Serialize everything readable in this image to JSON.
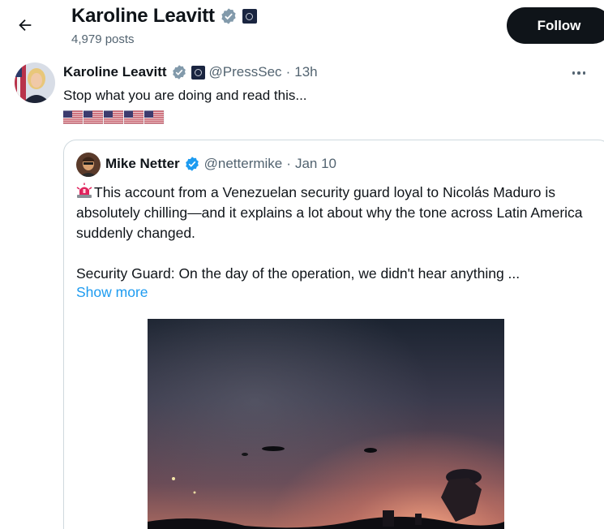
{
  "header": {
    "name": "Karoline Leavitt",
    "post_count": "4,979 posts",
    "follow_label": "Follow"
  },
  "post": {
    "author_name": "Karoline Leavitt",
    "handle": "@PressSec",
    "separator": "·",
    "time": "13h",
    "text": "Stop what you are doing and read this...",
    "flags": [
      "us-flag-emoji",
      "us-flag-emoji",
      "us-flag-emoji",
      "us-flag-emoji",
      "us-flag-emoji"
    ]
  },
  "quote": {
    "author_name": "Mike Netter",
    "handle": "@nettermike",
    "separator": "·",
    "date": "Jan 10",
    "paragraph1": "This account from a Venezuelan security guard loyal to Nicolás Maduro is absolutely chilling—and it explains a lot about why the tone across Latin America suddenly changed.",
    "paragraph2": "Security Guard: On the day of the operation, we didn't hear anything ...",
    "show_more": "Show more"
  },
  "icons": {
    "back": "arrow-left-icon",
    "verified": "verified-badge-icon",
    "government": "government-seal-icon",
    "more": "more-options-icon",
    "alarm": "rotating-light-emoji"
  },
  "colors": {
    "accent": "#1d9bf0",
    "text": "#0f1419",
    "muted": "#536471",
    "border": "#cfd9de",
    "follow_bg": "#0f1419"
  }
}
